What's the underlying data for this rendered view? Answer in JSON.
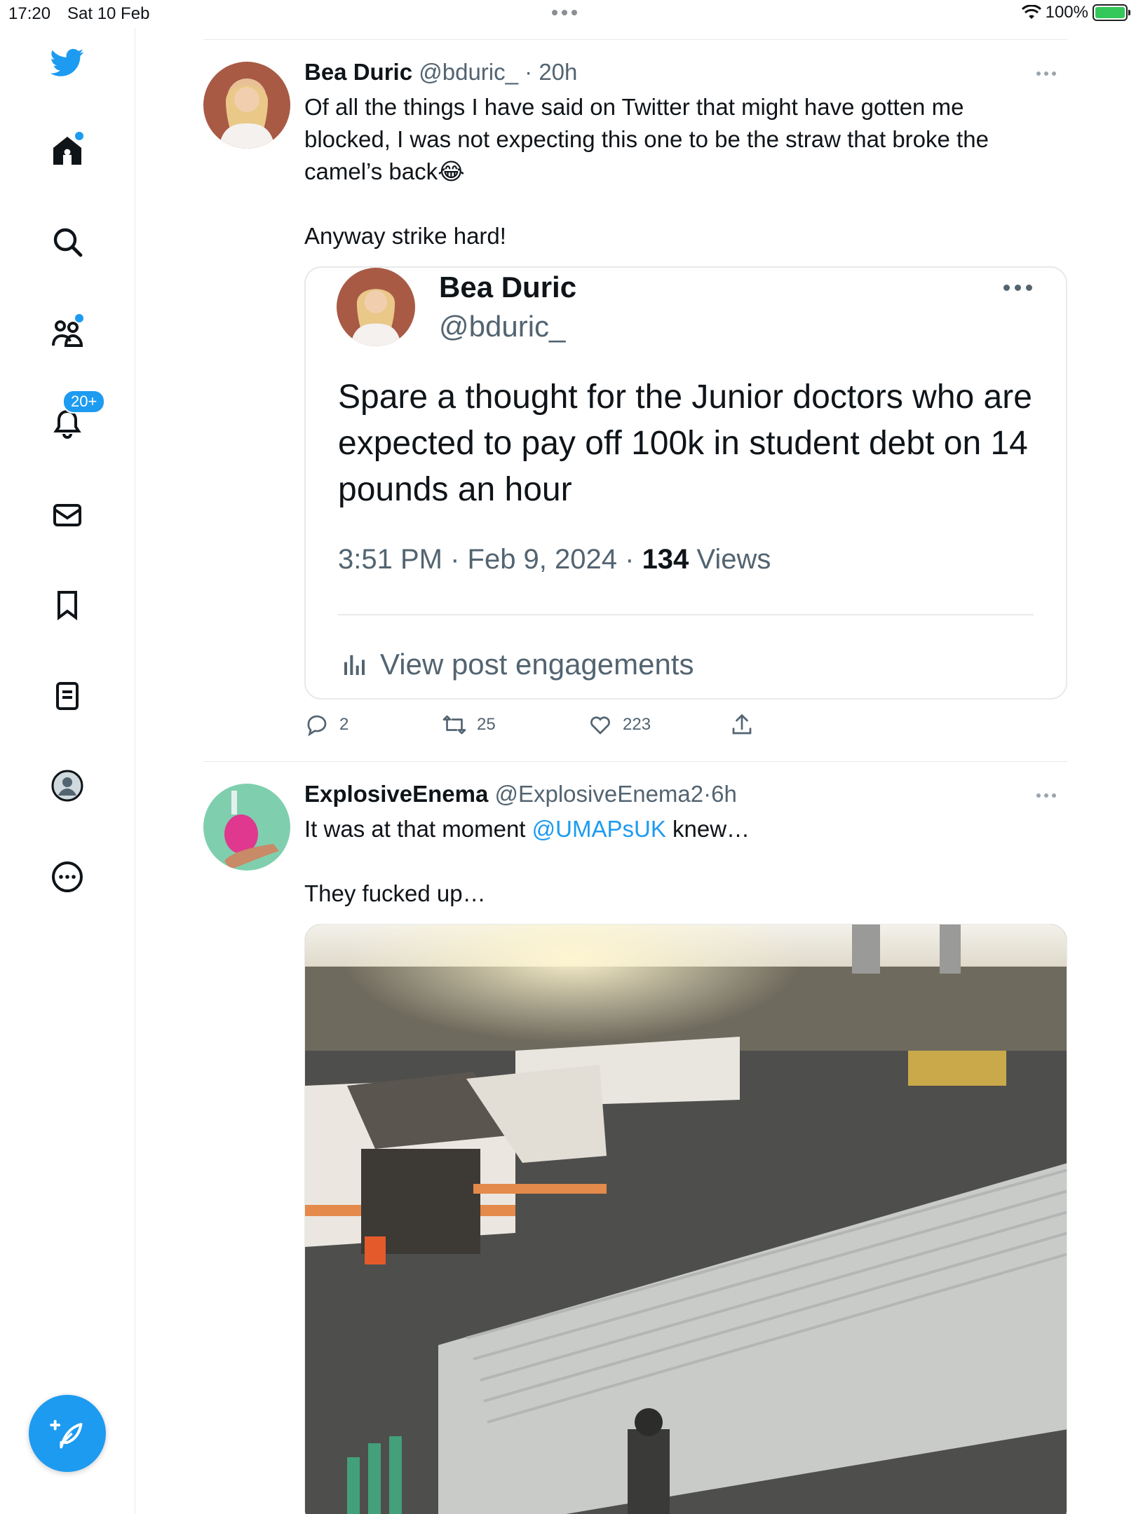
{
  "status_bar": {
    "time": "17:20",
    "date": "Sat 10 Feb",
    "battery": "100%"
  },
  "sidebar": {
    "items": [
      {
        "icon": "twitter-bird-icon"
      },
      {
        "icon": "home-icon",
        "has_dot": true
      },
      {
        "icon": "search-icon"
      },
      {
        "icon": "communities-icon",
        "has_dot": true
      },
      {
        "icon": "bell-icon",
        "badge": "20+"
      },
      {
        "icon": "mail-icon"
      },
      {
        "icon": "bookmark-icon"
      },
      {
        "icon": "lists-icon"
      },
      {
        "icon": "profile-avatar-icon"
      },
      {
        "icon": "more-circle-icon"
      }
    ],
    "notification_badge": "20+"
  },
  "tweets": [
    {
      "name": "Bea Duric",
      "handle": "@bduric_",
      "sep": "·",
      "time": "20h",
      "text_line1": "Of all the things I have said on Twitter that might have gotten me blocked, I was not expecting this one to be the straw that broke the camel’s back😂",
      "text_line2": "Anyway strike hard!",
      "quote": {
        "name": "Bea Duric",
        "handle": "@bduric_",
        "text": "Spare a thought for the Junior doctors who are expected to pay off 100k in student debt on 14 pounds an hour",
        "datetime": "3:51 PM · Feb 9, 2024 · ",
        "views_count": "134",
        "views_label": " Views",
        "engagements": "View post engagements"
      },
      "replies": "2",
      "retweets": "25",
      "likes": "223"
    },
    {
      "name": "ExplosiveEnema",
      "handle": "@ExplosiveEnema2",
      "sep": "·",
      "time": "6h",
      "text_before": "It was at that moment ",
      "mention": "@UMAPsUK",
      "text_after": " knew…",
      "text_line2": "They fucked up…"
    }
  ],
  "colors": {
    "accent": "#1d9bf0",
    "text_primary": "#0f1419",
    "text_secondary": "#536471",
    "border": "#e7e9ea"
  }
}
